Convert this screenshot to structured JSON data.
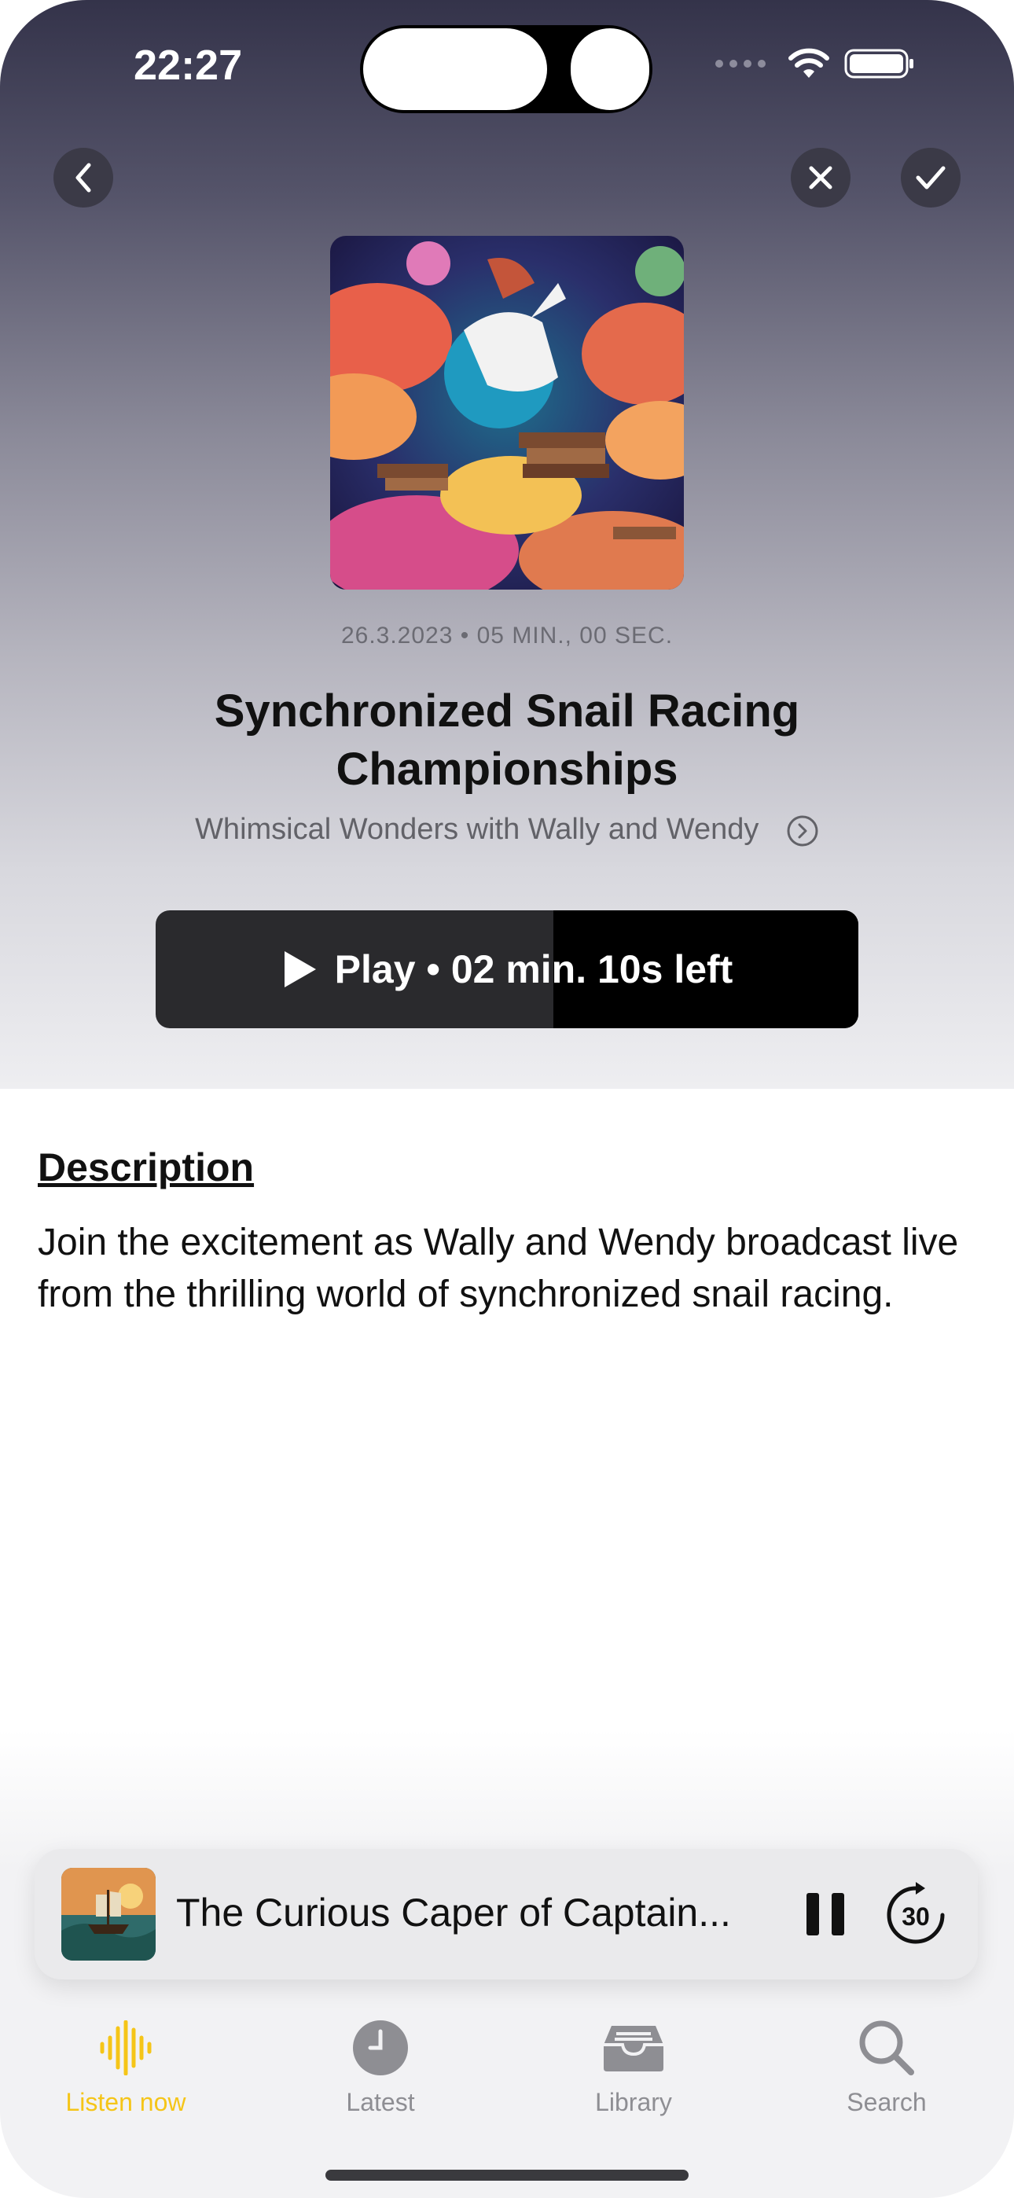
{
  "status_bar": {
    "time": "22:27"
  },
  "nav": {
    "back": "back",
    "close": "close",
    "done": "done"
  },
  "episode": {
    "date": "26.3.2023",
    "duration": "05 MIN., 00 SEC.",
    "title": "Synchronized Snail Racing Championships",
    "podcast": "Whimsical Wonders with Wally and Wendy",
    "progress_fraction": 0.566
  },
  "play_button": {
    "label": "Play • 02 min. 10s left"
  },
  "description": {
    "heading": "Description",
    "body": "Join the excitement as Wally and Wendy broadcast live from the thrilling world of synchronized snail racing."
  },
  "mini_player": {
    "title": "The Curious Caper of Captain...",
    "skip_seconds": "30"
  },
  "tab_bar": {
    "items": [
      {
        "label": "Listen now",
        "icon": "waveform-icon",
        "active": true
      },
      {
        "label": "Latest",
        "icon": "clock-icon",
        "active": false
      },
      {
        "label": "Library",
        "icon": "tray-icon",
        "active": false
      },
      {
        "label": "Search",
        "icon": "magnifier-icon",
        "active": false
      }
    ]
  },
  "colors": {
    "accent": "#f5c518",
    "inactive": "#8e8e93",
    "play_bg": "#2a2a2d"
  }
}
